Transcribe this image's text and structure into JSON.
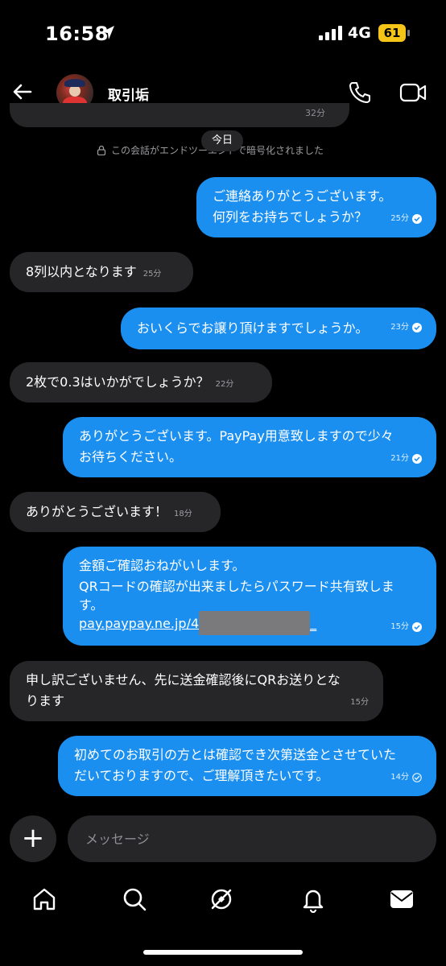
{
  "status_bar": {
    "time": "16:58",
    "network": "4G",
    "battery": "61"
  },
  "header": {
    "contact_name": "取引垢"
  },
  "thread": {
    "prev_time": "32分",
    "date_label": "今日",
    "encryption_notice": "この会話がエンドツーエンドで暗号化されました"
  },
  "messages": [
    {
      "dir": "out",
      "text1": "ご連絡ありがとうございます。",
      "text2": "何列をお持ちでしょうか？",
      "time": "25分"
    },
    {
      "dir": "in",
      "text": "8列以内となります",
      "time": "25分"
    },
    {
      "dir": "out",
      "text": "おいくらでお譲り頂けますでしょうか。",
      "time": "23分"
    },
    {
      "dir": "in",
      "text": "2枚で0.3はいかがでしょうか？",
      "time": "22分"
    },
    {
      "dir": "out",
      "text1": "ありがとうございます。PayPay用意致しますので少々",
      "text2": "お待ちください。",
      "time": "21分"
    },
    {
      "dir": "in",
      "text": "ありがとうございます！",
      "time": "18分"
    },
    {
      "dir": "out",
      "text1": "金額ご確認おねがいします。",
      "text2": "QRコードの確認が出来ましたらパスワード共有致しま",
      "text3": "す。",
      "link_prefix": "pay.paypay.ne.jp/4",
      "link_suffix": "_",
      "time": "15分"
    },
    {
      "dir": "in",
      "text1": "申し訳ございません、先に送金確認後にQRお送りとな",
      "text2": "ります",
      "time": "15分"
    },
    {
      "dir": "out",
      "text1": "初めてのお取引の方とは確認でき次第送金とさせていた",
      "text2": "だいておりますので、ご理解頂きたいです。",
      "time": "14分"
    }
  ],
  "composer": {
    "placeholder": "メッセージ"
  },
  "colors": {
    "outgoing_bubble": "#1b8ff0",
    "incoming_bubble": "#262628",
    "battery": "#f5c518"
  },
  "nav": [
    "home-icon",
    "search-icon",
    "explore-icon",
    "notifications-icon",
    "inbox-icon"
  ]
}
